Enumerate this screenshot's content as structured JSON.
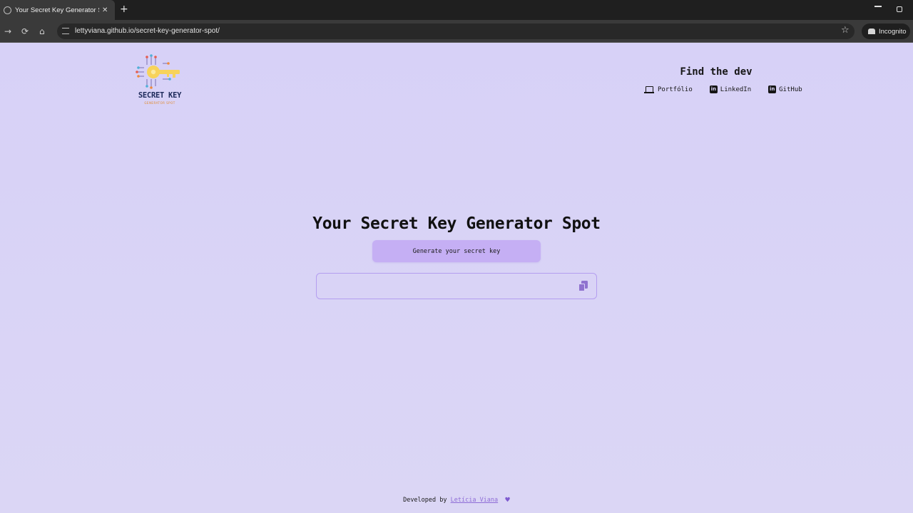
{
  "browser": {
    "tab_title": "Your Secret Key Generator Spot",
    "tab_close": "✕",
    "new_tab": "+",
    "url": "lettyviana.github.io/secret-key-generator-spot/",
    "incognito_label": "Incognito",
    "icons": [
      "back-arrow-icon",
      "reload-icon",
      "home-icon",
      "site-settings-icon",
      "bookmark-star-icon",
      "incognito-icon",
      "minimize-icon",
      "restore-icon"
    ]
  },
  "logo": {
    "title": "SECRET KEY",
    "subtitle": "GENERATOR SPOT"
  },
  "dev": {
    "title": "Find the dev",
    "links": [
      {
        "label": "Portfólio",
        "icon": "laptop-icon"
      },
      {
        "label": "LinkedIn",
        "icon": "linkedin-icon"
      },
      {
        "label": "GitHub",
        "icon": "linkedin-icon"
      }
    ]
  },
  "main": {
    "title": "Your Secret Key Generator Spot",
    "generate_label": "Generate your secret key",
    "key_value": "",
    "copy_icon": "copy-icon"
  },
  "footer": {
    "prefix": "Developed by",
    "author": "Letícia Viana",
    "heart": "💜"
  },
  "colors": {
    "page_bg": "#d8d2f6",
    "button_bg": "#c5aff4",
    "accent": "#8f72cf",
    "link": "#8d6bd6"
  }
}
